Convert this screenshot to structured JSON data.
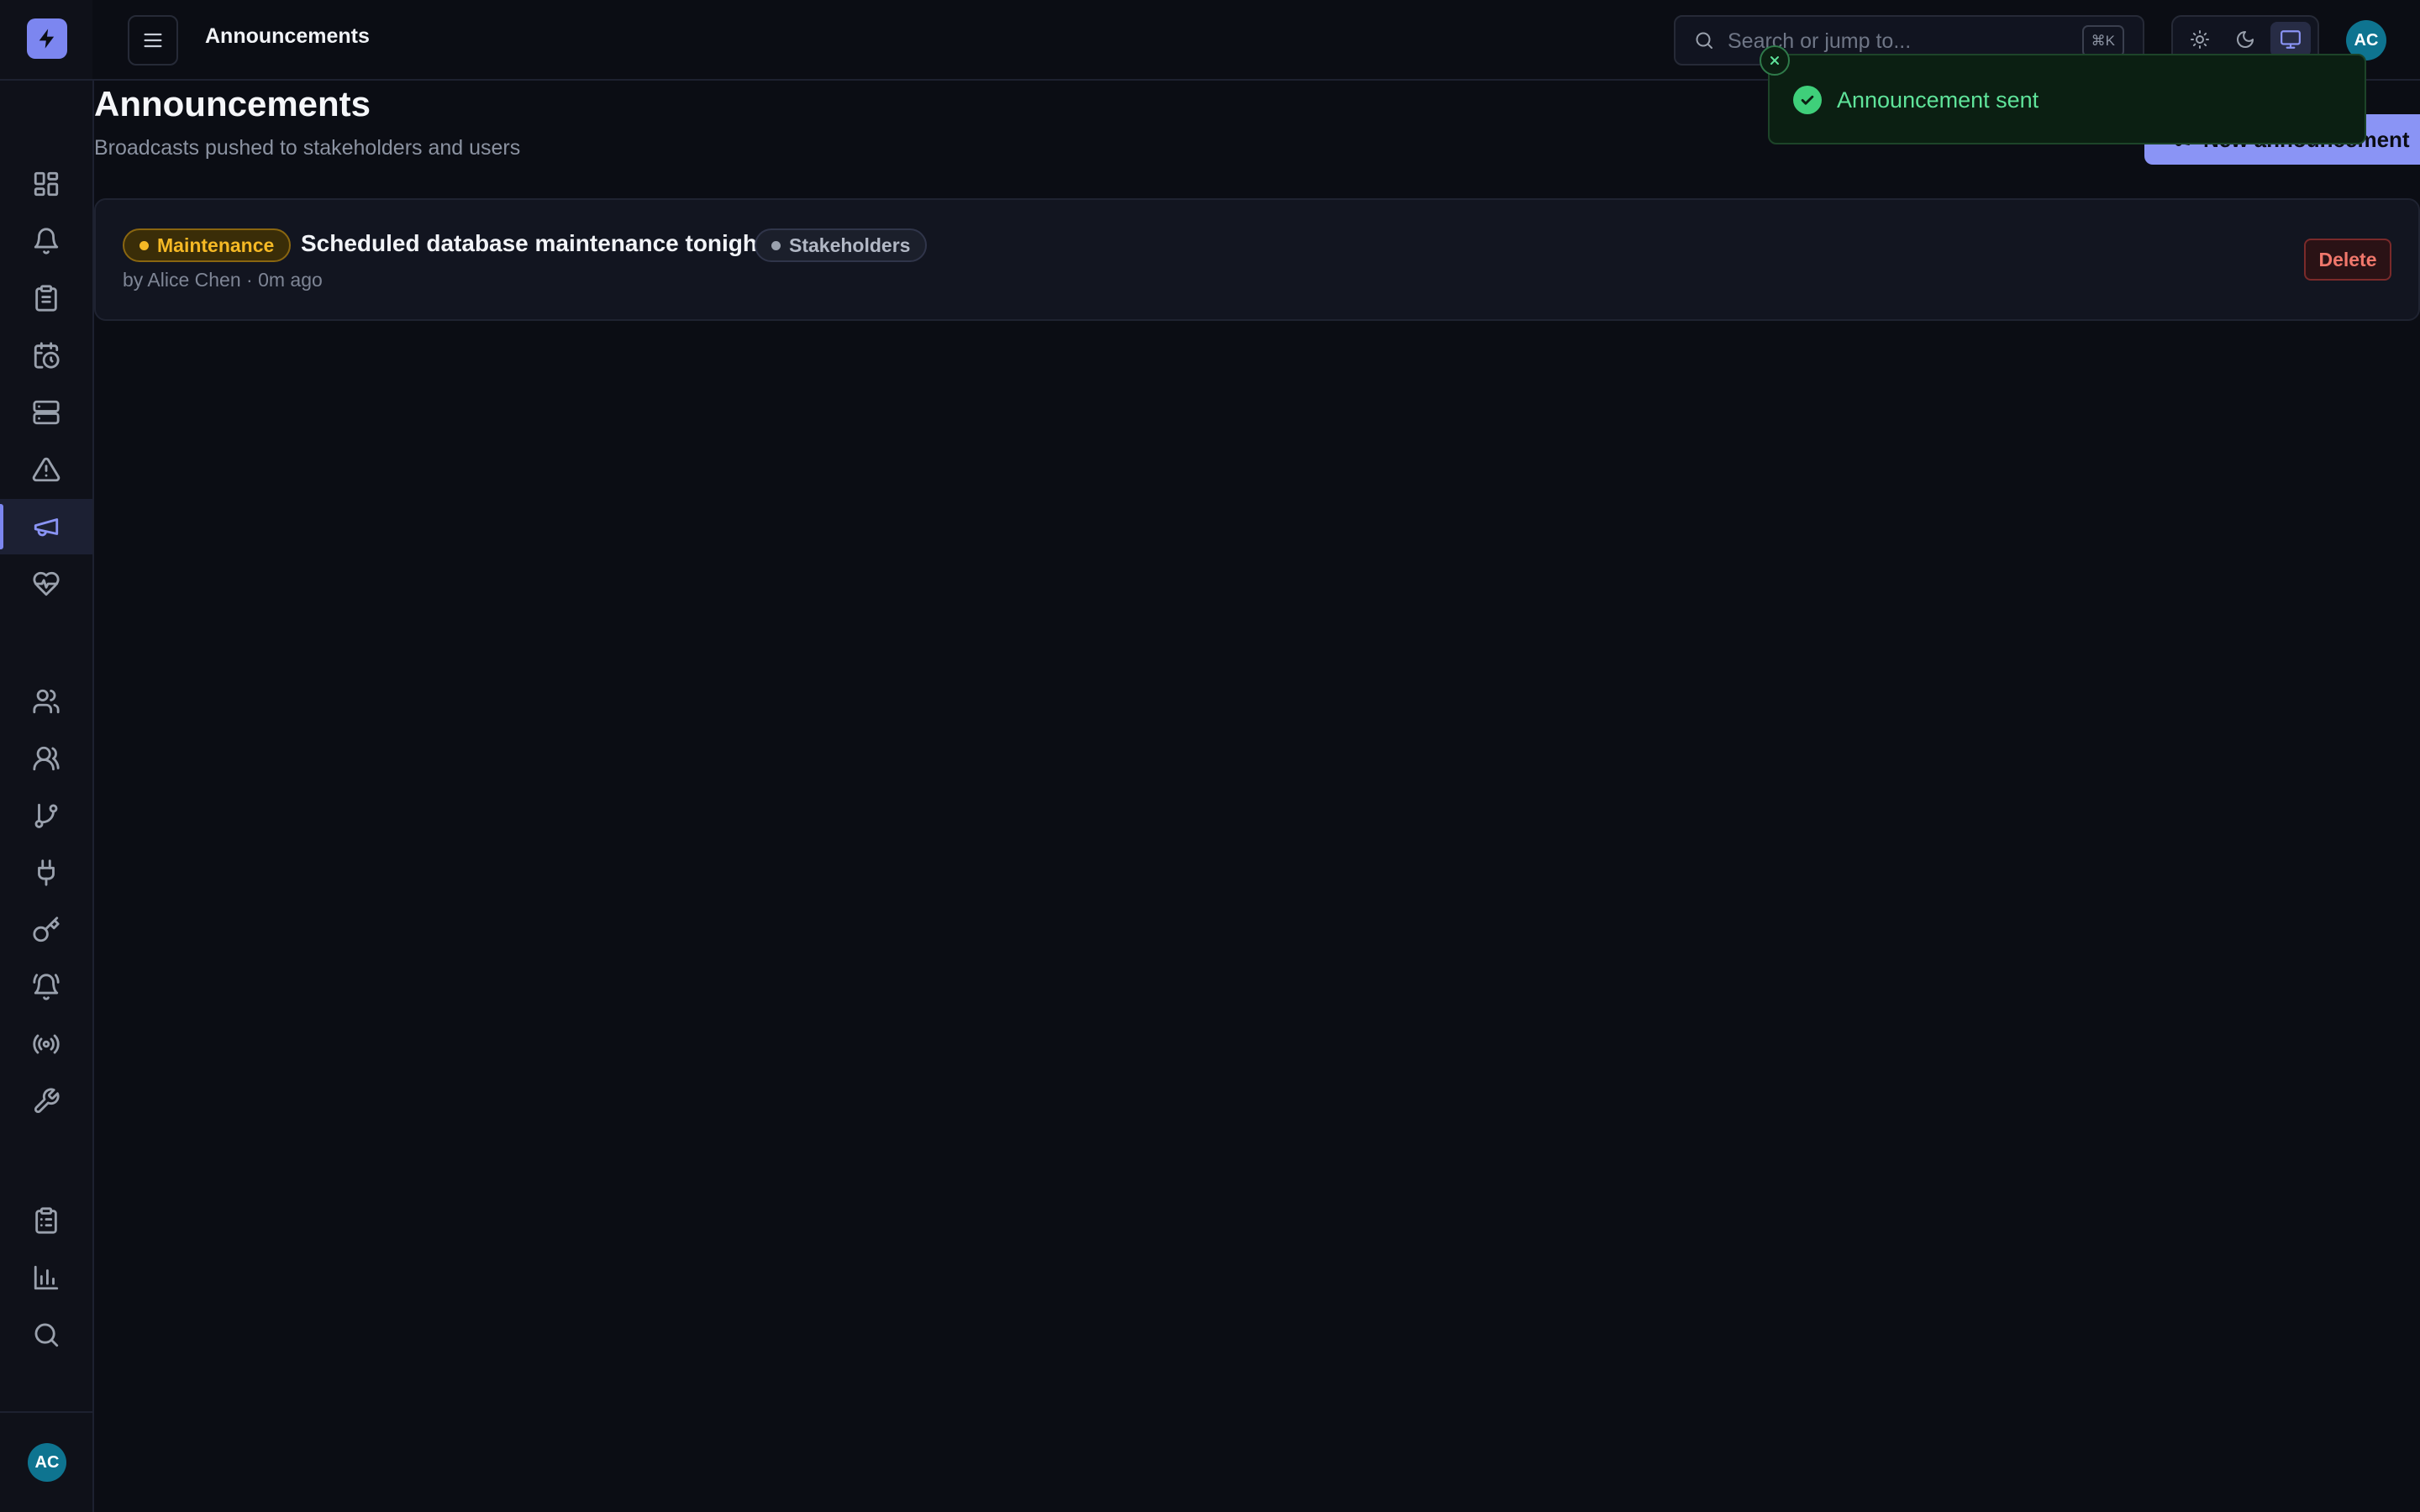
{
  "app": {
    "user_initials": "AC"
  },
  "header": {
    "title": "Announcements",
    "search_placeholder": "Search or jump to...",
    "search_shortcut": "⌘K",
    "theme_options": [
      "light",
      "dark",
      "system"
    ],
    "theme_selected": "system"
  },
  "sidebar": {
    "items": [
      {
        "id": "dashboard",
        "icon": "dashboard-grid-icon",
        "active": false
      },
      {
        "id": "alerts",
        "icon": "bell-icon",
        "active": false
      },
      {
        "id": "incidents",
        "icon": "clipboard-icon",
        "active": false
      },
      {
        "id": "schedules",
        "icon": "calendar-clock-icon",
        "active": false
      },
      {
        "id": "services",
        "icon": "server-icon",
        "active": false
      },
      {
        "id": "escalations",
        "icon": "warning-triangle-icon",
        "active": false
      },
      {
        "id": "announcements",
        "icon": "megaphone-icon",
        "active": true
      },
      {
        "id": "status",
        "icon": "heart-pulse-icon",
        "active": false
      },
      {
        "id": "users",
        "icon": "users-icon",
        "active": false
      },
      {
        "id": "teams",
        "icon": "team-icon",
        "active": false
      },
      {
        "id": "workflows",
        "icon": "git-branch-icon",
        "active": false
      },
      {
        "id": "integrations",
        "icon": "plug-icon",
        "active": false
      },
      {
        "id": "api-keys",
        "icon": "key-icon",
        "active": false
      },
      {
        "id": "notification-rules",
        "icon": "bell-ring-icon",
        "active": false
      },
      {
        "id": "broadcast",
        "icon": "radio-icon",
        "active": false
      },
      {
        "id": "settings",
        "icon": "wrench-icon",
        "active": false
      },
      {
        "id": "audit-log",
        "icon": "clipboard-list-icon",
        "active": false
      },
      {
        "id": "reports",
        "icon": "bar-chart-icon",
        "active": false
      },
      {
        "id": "search",
        "icon": "search-icon",
        "active": false
      }
    ]
  },
  "page": {
    "title": "Announcements",
    "subtitle": "Broadcasts pushed to stakeholders and users",
    "new_button_label": "New announcement"
  },
  "announcements": [
    {
      "type": "Maintenance",
      "type_color": "#f5b925",
      "title": "Scheduled database maintenance tonight",
      "audience": "Stakeholders",
      "audience_color": "#9aa1ad",
      "meta": "by Alice Chen · 0m ago",
      "delete_label": "Delete"
    }
  ],
  "toast": {
    "message": "Announcement sent",
    "type": "success"
  },
  "colors": {
    "accent": "#8a94f5",
    "background": "#0b0d14",
    "success": "#3fcf7a",
    "danger": "#f0776b"
  }
}
